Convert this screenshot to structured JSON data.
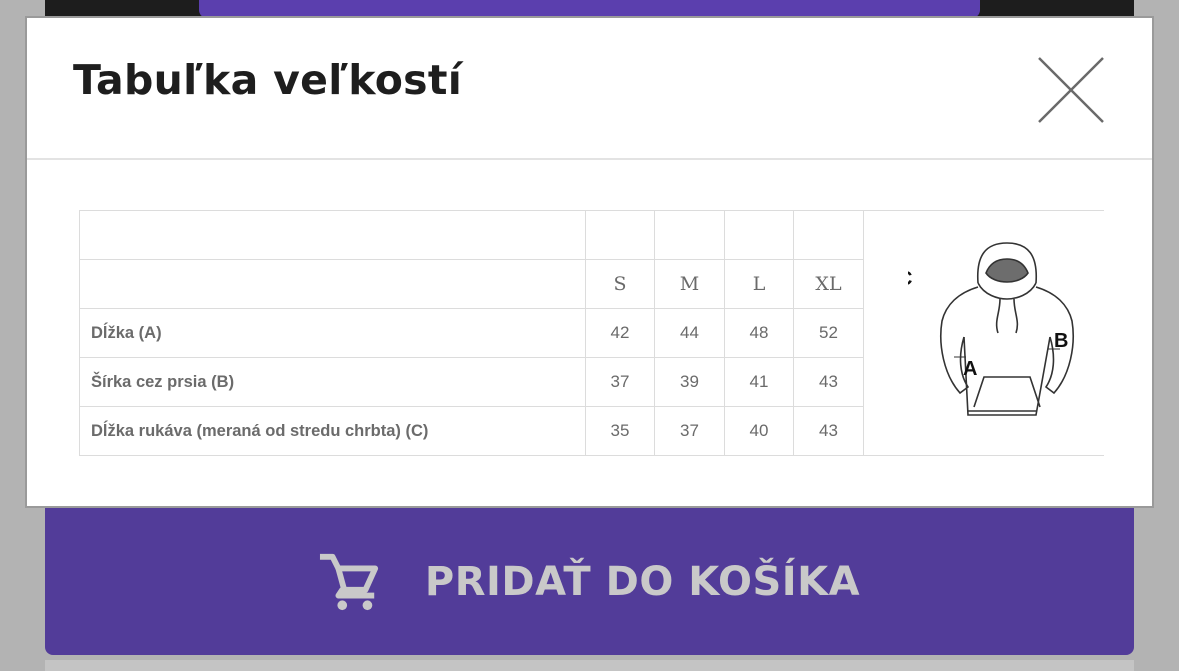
{
  "modal": {
    "title": "Tabuľka veľkostí",
    "close_icon": "close-icon"
  },
  "size_table": {
    "sizes": [
      "S",
      "M",
      "L",
      "XL"
    ],
    "rows": [
      {
        "label": "Dĺžka (A)",
        "values": [
          "42",
          "44",
          "48",
          "52"
        ]
      },
      {
        "label": "Šírka cez prsia (B)",
        "values": [
          "37",
          "39",
          "41",
          "43"
        ]
      },
      {
        "label": "Dĺžka rukáva (meraná od stredu chrbta) (C)",
        "values": [
          "35",
          "37",
          "40",
          "43"
        ]
      }
    ],
    "diagram_icon": "hoodie-diagram-icon",
    "diagram_labels": {
      "a": "A",
      "b": "B",
      "c": "C"
    }
  },
  "cart_button": {
    "label": "PRIDAŤ DO KOŠÍKA",
    "icon": "cart-icon"
  },
  "colors": {
    "accent_purple": "#523c99",
    "backdrop": "#b3b3b3",
    "title_text": "#1e1e1e",
    "table_text": "#6a6a6a"
  }
}
